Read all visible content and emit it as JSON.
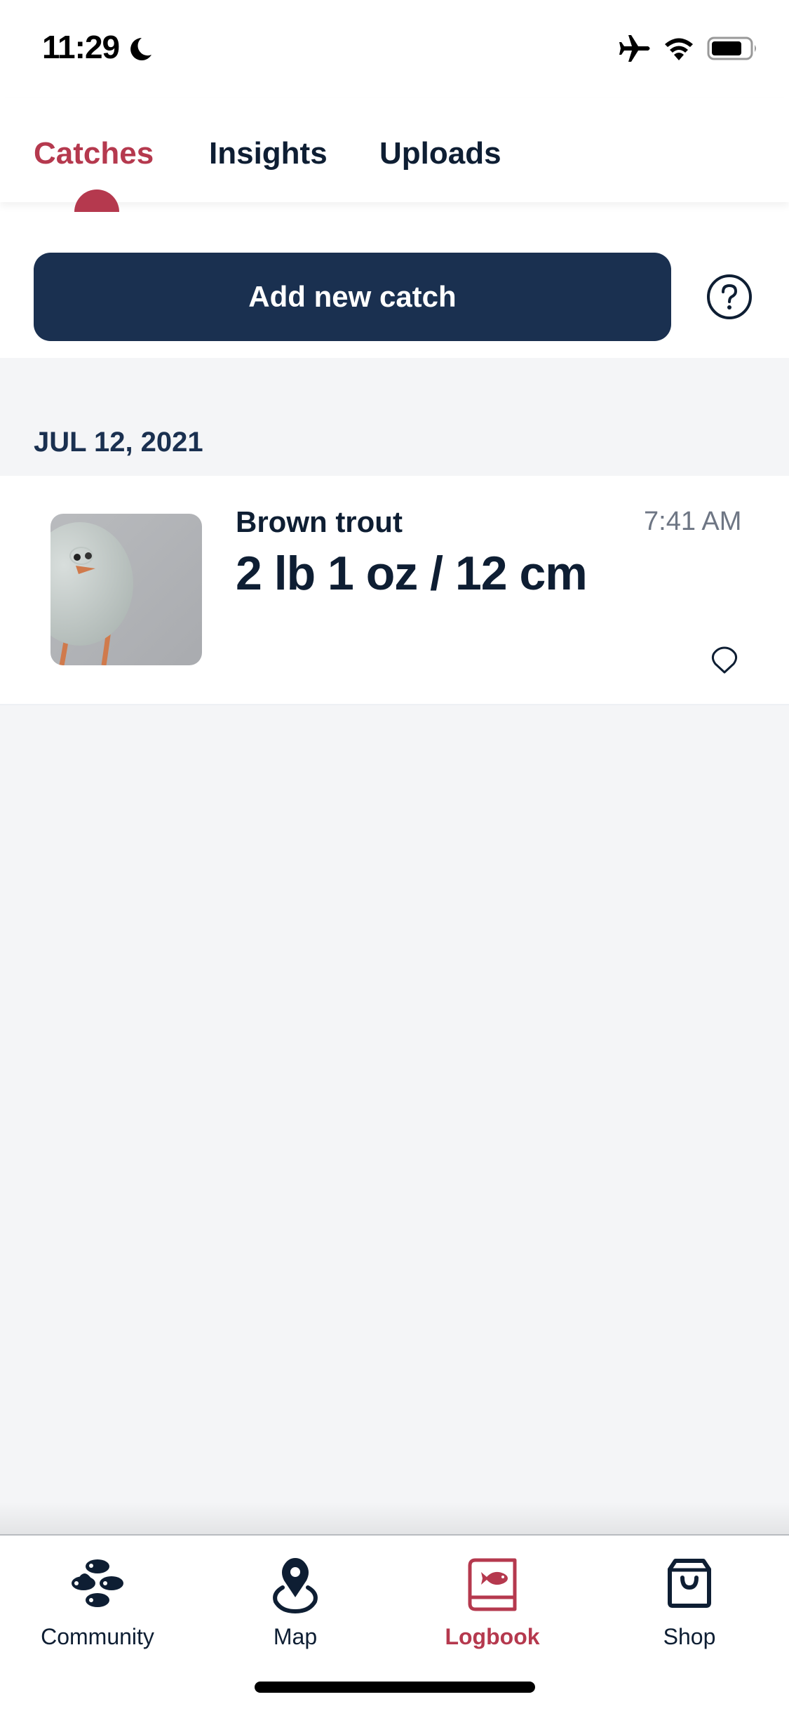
{
  "status_bar": {
    "time": "11:29",
    "icons": [
      "moon-icon",
      "airplane-icon",
      "wifi-icon",
      "battery-icon"
    ]
  },
  "tabs": [
    {
      "label": "Catches",
      "active": true
    },
    {
      "label": "Insights",
      "active": false
    },
    {
      "label": "Uploads",
      "active": false
    }
  ],
  "actions": {
    "add_label": "Add new catch",
    "help_icon": "question-circle-icon"
  },
  "catches": {
    "groups": [
      {
        "date": "JUL 12, 2021",
        "items": [
          {
            "species": "Brown trout",
            "measurement": "2 lb 1 oz / 12 cm",
            "time": "7:41 AM",
            "thumbnail": "egg-character-photo",
            "location_icon": "location-pin-outline-icon"
          }
        ]
      }
    ]
  },
  "bottom_nav": {
    "items": [
      {
        "label": "Community",
        "icon": "fish-school-icon",
        "active": false
      },
      {
        "label": "Map",
        "icon": "map-pin-icon",
        "active": false
      },
      {
        "label": "Logbook",
        "icon": "fish-book-icon",
        "active": true
      },
      {
        "label": "Shop",
        "icon": "shopping-bag-icon",
        "active": false
      }
    ]
  },
  "colors": {
    "accent": "#B5394E",
    "navy": "#0E1E33",
    "button": "#1A3050",
    "background": "#F4F5F7",
    "muted_text": "#6E7684"
  }
}
